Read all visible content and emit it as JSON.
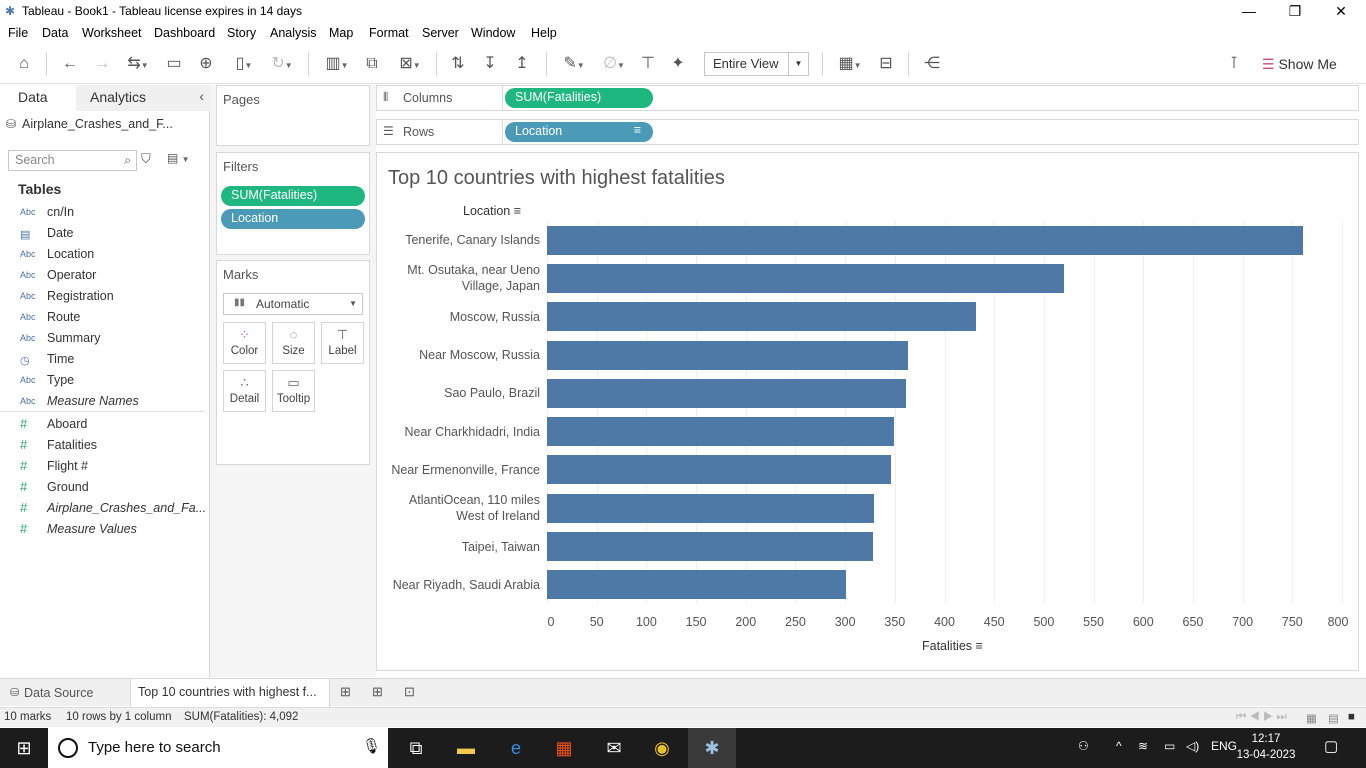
{
  "window": {
    "title": "Tableau - Book1 - Tableau license expires in 14 days"
  },
  "menu": [
    "File",
    "Data",
    "Worksheet",
    "Dashboard",
    "Story",
    "Analysis",
    "Map",
    "Format",
    "Server",
    "Window",
    "Help"
  ],
  "toolbar": {
    "fit_mode": "Entire View",
    "show_me": "Show Me"
  },
  "data_pane": {
    "tabs": {
      "data": "Data",
      "analytics": "Analytics"
    },
    "datasource": "Airplane_Crashes_and_F...",
    "search_placeholder": "Search",
    "tables_label": "Tables",
    "dimensions": [
      {
        "type": "Abc",
        "name": "cn/In"
      },
      {
        "type": "date",
        "name": "Date"
      },
      {
        "type": "Abc",
        "name": "Location"
      },
      {
        "type": "Abc",
        "name": "Operator"
      },
      {
        "type": "Abc",
        "name": "Registration"
      },
      {
        "type": "Abc",
        "name": "Route"
      },
      {
        "type": "Abc",
        "name": "Summary"
      },
      {
        "type": "time",
        "name": "Time"
      },
      {
        "type": "Abc",
        "name": "Type"
      },
      {
        "type": "Abc",
        "name": "Measure Names"
      }
    ],
    "measures": [
      {
        "type": "#",
        "name": "Aboard"
      },
      {
        "type": "#",
        "name": "Fatalities"
      },
      {
        "type": "#",
        "name": "Flight #"
      },
      {
        "type": "#",
        "name": "Ground"
      },
      {
        "type": "#",
        "name": "Airplane_Crashes_and_Fa..."
      },
      {
        "type": "#",
        "name": "Measure Values"
      }
    ]
  },
  "cards": {
    "pages": "Pages",
    "filters": "Filters",
    "filter_pills": [
      "SUM(Fatalities)",
      "Location"
    ],
    "marks": "Marks",
    "mark_type": "Automatic",
    "mark_buttons": [
      "Color",
      "Size",
      "Label",
      "Detail",
      "Tooltip"
    ]
  },
  "shelves": {
    "columns_label": "Columns",
    "columns_pill": "SUM(Fatalities)",
    "rows_label": "Rows",
    "rows_pill": "Location"
  },
  "chart_data": {
    "type": "bar",
    "orientation": "horizontal",
    "title": "Top 10 countries with highest fatalities",
    "ylabel": "Location",
    "xlabel": "Fatalities",
    "categories": [
      "Tenerife, Canary Islands",
      "Mt. Osutaka, near Ueno Village, Japan",
      "Moscow, Russia",
      "Near Moscow, Russia",
      "Sao Paulo, Brazil",
      "Near Charkhidadri, India",
      "Near Ermenonville, France",
      "AtlantiOcean, 110 miles West of Ireland",
      "Taipei, Taiwan",
      "Near Riyadh, Saudi Arabia"
    ],
    "category_lines": [
      [
        "Tenerife, Canary Islands"
      ],
      [
        "Mt. Osutaka, near Ueno",
        "Village, Japan"
      ],
      [
        "Moscow, Russia"
      ],
      [
        "Near Moscow, Russia"
      ],
      [
        "Sao Paulo, Brazil"
      ],
      [
        "Near Charkhidadri, India"
      ],
      [
        "Near Ermenonville, France"
      ],
      [
        "AtlantiOcean, 110 miles",
        "West of Ireland"
      ],
      [
        "Taipei, Taiwan"
      ],
      [
        "Near Riyadh, Saudi Arabia"
      ]
    ],
    "values": [
      761,
      520,
      432,
      363,
      361,
      349,
      346,
      329,
      328,
      301
    ],
    "xlim": [
      0,
      800
    ],
    "xticks": [
      0,
      50,
      100,
      150,
      200,
      250,
      300,
      350,
      400,
      450,
      500,
      550,
      600,
      650,
      700,
      750,
      800
    ],
    "grid": true,
    "color": "#4e79a7"
  },
  "sheet_tabs": {
    "data_source": "Data Source",
    "active_sheet": "Top 10 countries with highest f..."
  },
  "status": {
    "marks": "10 marks",
    "shape": "10 rows by 1 column",
    "sum": "SUM(Fatalities): 4,092"
  },
  "taskbar": {
    "search_placeholder": "Type here to search",
    "lang": "ENG",
    "time": "12:17",
    "date": "13-04-2023"
  }
}
